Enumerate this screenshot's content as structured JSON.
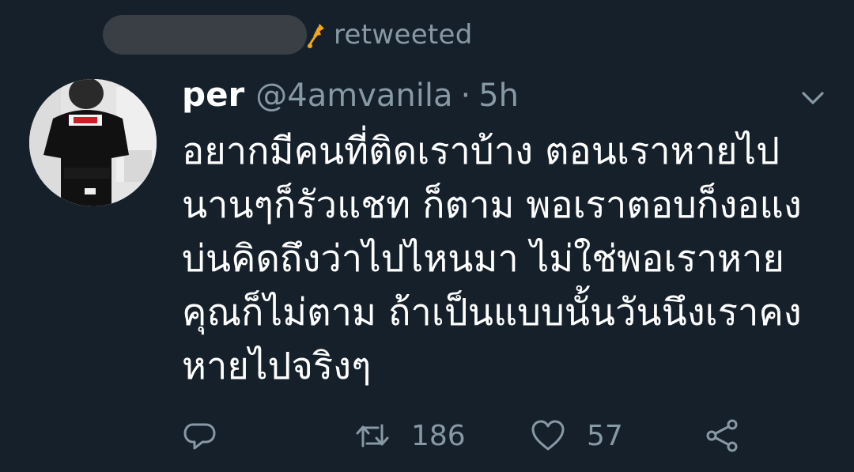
{
  "retweet_banner": {
    "label": "retweeted"
  },
  "tweet": {
    "display_name": "per",
    "handle": "@4amvanila",
    "separator": "·",
    "time": "5h",
    "text_lines": [
      "อยากมีคนที่ติดเราบ้าง ตอนเราหายไป",
      "นานๆก็รัวแชท ก็ตาม พอเราตอบก็งอแง",
      "บ่นคิดถึงว่าไปไหนมา ไม่ใช่พอเราหาย",
      "คุณก็ไม่ตาม ถ้าเป็นแบบนั้นวันนึงเราคง",
      "หายไปจริงๆ"
    ]
  },
  "actions": {
    "reply_icon": "reply-icon",
    "retweet_icon": "retweet-icon",
    "retweet_count": "186",
    "like_icon": "heart-icon",
    "like_count": "57",
    "share_icon": "share-icon"
  },
  "colors": {
    "background": "#15202b",
    "secondary_text": "#8899a6",
    "primary_text": "#ffffff",
    "retweet_badge": "#f4a51c"
  }
}
